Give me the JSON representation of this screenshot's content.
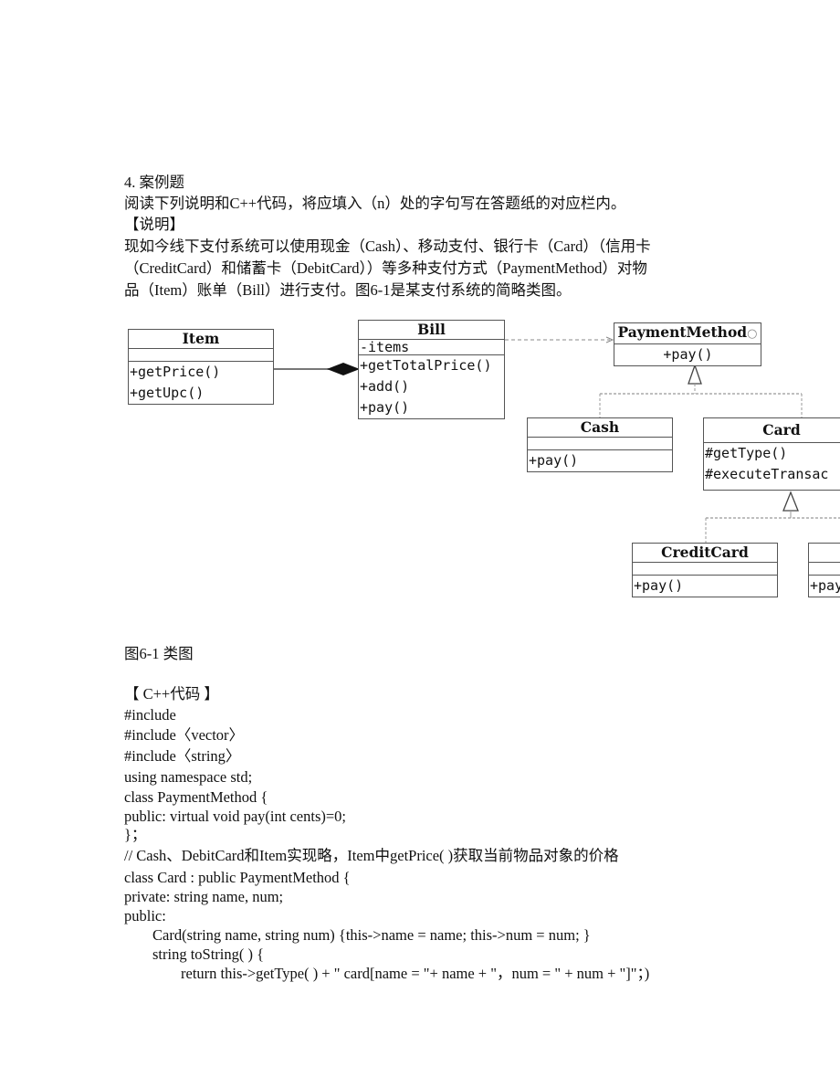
{
  "question": {
    "title": "4. 案例题",
    "instruction": "阅读下列说明和C++代码，将应填入（n）处的字句写在答题纸的对应栏内。",
    "section_description": "【说明】",
    "description_lines": [
      "现如今线下支付系统可以使用现金（Cash）、移动支付、银行卡（Card）（信用卡",
      "（CreditCard）和储蓄卡（DebitCard））等多种支付方式（PaymentMethod）对物",
      "品（Item）账单（Bill）进行支付。图6-1是某支付系统的简略类图。"
    ]
  },
  "diagram": {
    "classes": {
      "item": {
        "name": "Item",
        "attributes": [],
        "operations": [
          "+getPrice()",
          "+getUpc()"
        ]
      },
      "bill": {
        "name": "Bill",
        "attributes": [
          "-items"
        ],
        "operations": [
          "+getTotalPrice()",
          "+add()",
          "+pay()"
        ]
      },
      "payment_method": {
        "name": "PaymentMethod",
        "interface_marker": "○",
        "operations": [
          "+pay()"
        ]
      },
      "cash": {
        "name": "Cash",
        "attributes": [],
        "operations": [
          "+pay()"
        ]
      },
      "card": {
        "name": "Card",
        "operations": [
          "#getType()",
          "#executeTransac"
        ]
      },
      "credit_card": {
        "name": "CreditCard",
        "attributes": [],
        "operations": [
          "+pay()"
        ]
      },
      "debit_card": {
        "name": "",
        "attributes": [],
        "operations": [
          "+pay"
        ]
      }
    },
    "relations": [
      {
        "type": "composition",
        "from": "Bill",
        "to": "Item"
      },
      {
        "type": "dependency",
        "from": "Bill",
        "to": "PaymentMethod"
      },
      {
        "type": "realization",
        "from": "Cash",
        "to": "PaymentMethod"
      },
      {
        "type": "realization",
        "from": "Card",
        "to": "PaymentMethod"
      },
      {
        "type": "generalization",
        "from": "CreditCard",
        "to": "Card"
      },
      {
        "type": "generalization",
        "from": "DebitCard",
        "to": "Card"
      }
    ],
    "caption": "图6-1  类图"
  },
  "code_section": {
    "heading": "【 C++代码 】",
    "lines": [
      "#include",
      "#include〈vector〉",
      "#include〈string〉",
      "using namespace std;",
      "class PaymentMethod {",
      "public: virtual void pay(int cents)=0;",
      "}；",
      "// Cash、DebitCard和Item实现略，Item中getPrice( )获取当前物品对象的价格",
      "class Card : public PaymentMethod {",
      "private: string name, num;",
      "public:",
      "Card(string name, string num) {this->name = name; this->num = num; }",
      "string toString( ) {",
      "return this->getType( ) + \" card[name = \"+ name + \"，num = \" + num + \"]\"；)"
    ]
  }
}
